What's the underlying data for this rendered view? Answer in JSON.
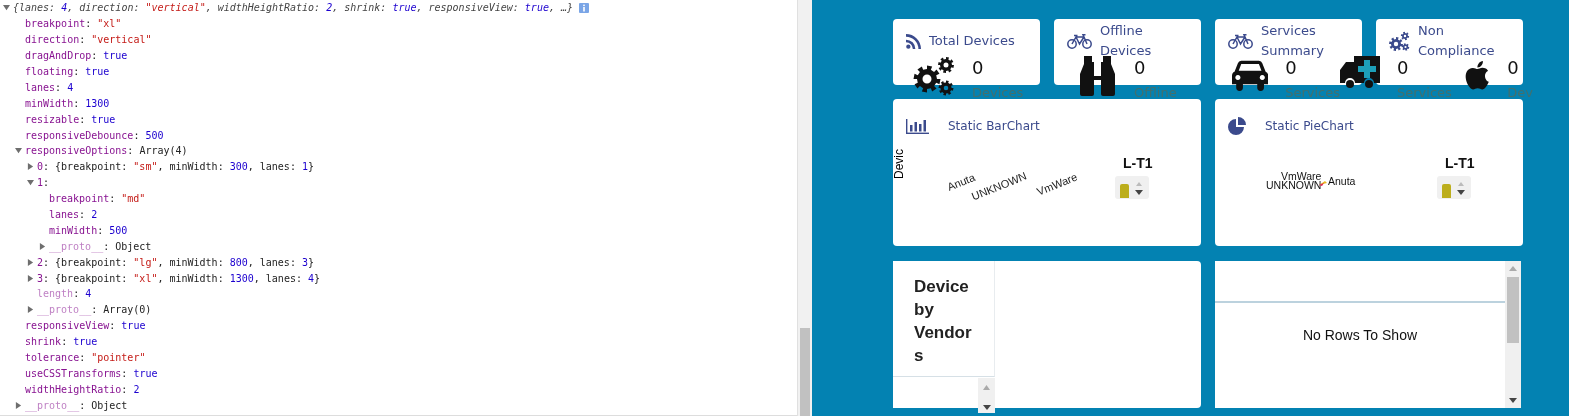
{
  "console": {
    "root": {
      "expanded": true,
      "tokens": [
        {
          "text": "{lanes: ",
          "kind": "plain"
        },
        {
          "text": "4",
          "kind": "number"
        },
        {
          "text": ", direction: ",
          "kind": "plain"
        },
        {
          "text": "\"vertical\"",
          "kind": "string"
        },
        {
          "text": ", widthHeightRatio: ",
          "kind": "plain"
        },
        {
          "text": "2",
          "kind": "number"
        },
        {
          "text": ", shrink: ",
          "kind": "plain"
        },
        {
          "text": "true",
          "kind": "number"
        },
        {
          "text": ", responsiveView: ",
          "kind": "plain"
        },
        {
          "text": "true",
          "kind": "number"
        },
        {
          "text": ", …}",
          "kind": "plain"
        }
      ],
      "children": [
        {
          "kind": "leaf",
          "faded": false,
          "tokens": [
            {
              "text": "breakpoint",
              "kind": "key"
            },
            {
              "text": ": ",
              "kind": "plain"
            },
            {
              "text": "\"xl\"",
              "kind": "string"
            }
          ]
        },
        {
          "kind": "leaf",
          "faded": false,
          "tokens": [
            {
              "text": "direction",
              "kind": "key"
            },
            {
              "text": ": ",
              "kind": "plain"
            },
            {
              "text": "\"vertical\"",
              "kind": "string"
            }
          ]
        },
        {
          "kind": "leaf",
          "faded": false,
          "tokens": [
            {
              "text": "dragAndDrop",
              "kind": "key"
            },
            {
              "text": ": ",
              "kind": "plain"
            },
            {
              "text": "true",
              "kind": "number"
            }
          ]
        },
        {
          "kind": "leaf",
          "faded": false,
          "tokens": [
            {
              "text": "floating",
              "kind": "key"
            },
            {
              "text": ": ",
              "kind": "plain"
            },
            {
              "text": "true",
              "kind": "number"
            }
          ]
        },
        {
          "kind": "leaf",
          "faded": false,
          "tokens": [
            {
              "text": "lanes",
              "kind": "key"
            },
            {
              "text": ": ",
              "kind": "plain"
            },
            {
              "text": "4",
              "kind": "number"
            }
          ]
        },
        {
          "kind": "leaf",
          "faded": false,
          "tokens": [
            {
              "text": "minWidth",
              "kind": "key"
            },
            {
              "text": ": ",
              "kind": "plain"
            },
            {
              "text": "1300",
              "kind": "number"
            }
          ]
        },
        {
          "kind": "leaf",
          "faded": false,
          "tokens": [
            {
              "text": "resizable",
              "kind": "key"
            },
            {
              "text": ": ",
              "kind": "plain"
            },
            {
              "text": "true",
              "kind": "number"
            }
          ]
        },
        {
          "kind": "leaf",
          "faded": false,
          "tokens": [
            {
              "text": "responsiveDebounce",
              "kind": "key"
            },
            {
              "text": ": ",
              "kind": "plain"
            },
            {
              "text": "500",
              "kind": "number"
            }
          ]
        },
        {
          "kind": "group",
          "expanded": true,
          "faded": false,
          "tokens": [
            {
              "text": "responsiveOptions",
              "kind": "key"
            },
            {
              "text": ": Array(4)",
              "kind": "plain"
            }
          ],
          "children": [
            {
              "kind": "group",
              "expanded": false,
              "faded": false,
              "tokens": [
                {
                  "text": "0",
                  "kind": "key"
                },
                {
                  "text": ": {breakpoint: ",
                  "kind": "plain"
                },
                {
                  "text": "\"sm\"",
                  "kind": "string"
                },
                {
                  "text": ", minWidth: ",
                  "kind": "plain"
                },
                {
                  "text": "300",
                  "kind": "number"
                },
                {
                  "text": ", lanes: ",
                  "kind": "plain"
                },
                {
                  "text": "1",
                  "kind": "number"
                },
                {
                  "text": "}",
                  "kind": "plain"
                }
              ]
            },
            {
              "kind": "group",
              "expanded": true,
              "faded": false,
              "tokens": [
                {
                  "text": "1",
                  "kind": "key"
                },
                {
                  "text": ":",
                  "kind": "plain"
                }
              ],
              "children": [
                {
                  "kind": "leaf",
                  "faded": false,
                  "tokens": [
                    {
                      "text": "breakpoint",
                      "kind": "key"
                    },
                    {
                      "text": ": ",
                      "kind": "plain"
                    },
                    {
                      "text": "\"md\"",
                      "kind": "string"
                    }
                  ]
                },
                {
                  "kind": "leaf",
                  "faded": false,
                  "tokens": [
                    {
                      "text": "lanes",
                      "kind": "key"
                    },
                    {
                      "text": ": ",
                      "kind": "plain"
                    },
                    {
                      "text": "2",
                      "kind": "number"
                    }
                  ]
                },
                {
                  "kind": "leaf",
                  "faded": false,
                  "tokens": [
                    {
                      "text": "minWidth",
                      "kind": "key"
                    },
                    {
                      "text": ": ",
                      "kind": "plain"
                    },
                    {
                      "text": "500",
                      "kind": "number"
                    }
                  ]
                },
                {
                  "kind": "group",
                  "expanded": false,
                  "faded": true,
                  "tokens": [
                    {
                      "text": "__proto__",
                      "kind": "key"
                    },
                    {
                      "text": ": Object",
                      "kind": "plain"
                    }
                  ]
                }
              ]
            },
            {
              "kind": "group",
              "expanded": false,
              "faded": false,
              "tokens": [
                {
                  "text": "2",
                  "kind": "key"
                },
                {
                  "text": ": {breakpoint: ",
                  "kind": "plain"
                },
                {
                  "text": "\"lg\"",
                  "kind": "string"
                },
                {
                  "text": ", minWidth: ",
                  "kind": "plain"
                },
                {
                  "text": "800",
                  "kind": "number"
                },
                {
                  "text": ", lanes: ",
                  "kind": "plain"
                },
                {
                  "text": "3",
                  "kind": "number"
                },
                {
                  "text": "}",
                  "kind": "plain"
                }
              ]
            },
            {
              "kind": "group",
              "expanded": false,
              "faded": false,
              "tokens": [
                {
                  "text": "3",
                  "kind": "key"
                },
                {
                  "text": ": {breakpoint: ",
                  "kind": "plain"
                },
                {
                  "text": "\"xl\"",
                  "kind": "string"
                },
                {
                  "text": ", minWidth: ",
                  "kind": "plain"
                },
                {
                  "text": "1300",
                  "kind": "number"
                },
                {
                  "text": ", lanes: ",
                  "kind": "plain"
                },
                {
                  "text": "4",
                  "kind": "number"
                },
                {
                  "text": "}",
                  "kind": "plain"
                }
              ]
            },
            {
              "kind": "leaf",
              "faded": true,
              "tokens": [
                {
                  "text": "length",
                  "kind": "key"
                },
                {
                  "text": ": ",
                  "kind": "plain"
                },
                {
                  "text": "4",
                  "kind": "number"
                }
              ]
            },
            {
              "kind": "group",
              "expanded": false,
              "faded": true,
              "tokens": [
                {
                  "text": "__proto__",
                  "kind": "key"
                },
                {
                  "text": ": Array(0)",
                  "kind": "plain"
                }
              ]
            }
          ]
        },
        {
          "kind": "leaf",
          "faded": false,
          "tokens": [
            {
              "text": "responsiveView",
              "kind": "key"
            },
            {
              "text": ": ",
              "kind": "plain"
            },
            {
              "text": "true",
              "kind": "number"
            }
          ]
        },
        {
          "kind": "leaf",
          "faded": false,
          "tokens": [
            {
              "text": "shrink",
              "kind": "key"
            },
            {
              "text": ": ",
              "kind": "plain"
            },
            {
              "text": "true",
              "kind": "number"
            }
          ]
        },
        {
          "kind": "leaf",
          "faded": false,
          "tokens": [
            {
              "text": "tolerance",
              "kind": "key"
            },
            {
              "text": ": ",
              "kind": "plain"
            },
            {
              "text": "\"pointer\"",
              "kind": "string"
            }
          ]
        },
        {
          "kind": "leaf",
          "faded": false,
          "tokens": [
            {
              "text": "useCSSTransforms",
              "kind": "key"
            },
            {
              "text": ": ",
              "kind": "plain"
            },
            {
              "text": "true",
              "kind": "number"
            }
          ]
        },
        {
          "kind": "leaf",
          "faded": false,
          "tokens": [
            {
              "text": "widthHeightRatio",
              "kind": "key"
            },
            {
              "text": ": ",
              "kind": "plain"
            },
            {
              "text": "2",
              "kind": "number"
            }
          ]
        }
      ]
    },
    "root_proto": {
      "kind": "group",
      "expanded": false,
      "faded": true,
      "tokens": [
        {
          "text": "__proto__",
          "kind": "key"
        },
        {
          "text": ": Object",
          "kind": "plain"
        }
      ]
    }
  },
  "cards": [
    {
      "title": "Total Devices"
    },
    {
      "title": "Offline Devices"
    },
    {
      "title": "Services Summary"
    },
    {
      "title": "Non Compliance"
    }
  ],
  "stats": [
    {
      "value": "0",
      "label": "Devices"
    },
    {
      "value": "0",
      "label": "Offline"
    },
    {
      "value": "0",
      "label": "Services"
    },
    {
      "value": "0",
      "label": "Services"
    },
    {
      "value": "0",
      "label": "Dev"
    }
  ],
  "bar_chart": {
    "title": "Static BarChart",
    "y_axis_label": "Devic",
    "category_labels": [
      "Anuta",
      "UNKNOWN",
      "VmWare"
    ],
    "legend": {
      "title": "L-T1"
    }
  },
  "pie_chart": {
    "title": "Static PieChart",
    "slice_labels": [
      "VmWare",
      "UNKNOWN",
      "Anuta"
    ],
    "legend": {
      "title": "L-T1"
    }
  },
  "vendors_panel": {
    "title": "Device by Vendors"
  },
  "grid_panel": {
    "empty_message": "No Rows To Show"
  }
}
